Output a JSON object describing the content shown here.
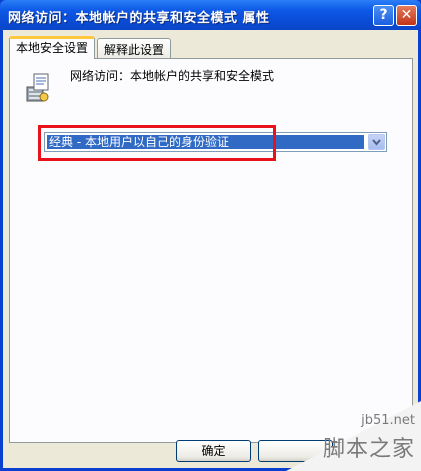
{
  "window": {
    "title": "网络访问：本地帐户的共享和安全模式 属性",
    "help_label": "?",
    "close_label": "✕"
  },
  "tabs": [
    {
      "label": "本地安全设置",
      "active": true
    },
    {
      "label": "解释此设置",
      "active": false
    }
  ],
  "policy": {
    "icon": "policy-server-icon",
    "name": "网络访问：本地帐户的共享和安全模式"
  },
  "dropdown": {
    "selected": "经典 - 本地用户以自己的身份验证",
    "arrow_icon": "chevron-down-icon"
  },
  "buttons": {
    "ok_label": "确定"
  },
  "watermark": {
    "site": "jb51.net",
    "name": "脚本之家"
  },
  "colors": {
    "title_bar": "#0a4cd6",
    "selection": "#316ac5",
    "highlight_box": "#e8121a",
    "active_tab_accent": "#ffc83c"
  }
}
